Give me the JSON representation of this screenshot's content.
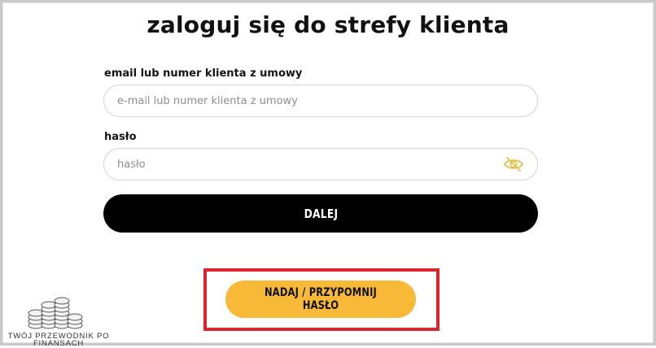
{
  "login": {
    "title": "zaloguj się do strefy klienta",
    "email_label": "email lub numer klienta z umowy",
    "email_placeholder": "e-mail lub numer klienta z umowy",
    "email_value": "",
    "password_label": "hasło",
    "password_placeholder": "hasło",
    "password_value": "",
    "password_toggle_icon": "eye-slash-icon",
    "next_button": "DALEJ",
    "forgot_button": "NADAJ / PRZYPOMNIJ HASŁO"
  },
  "colors": {
    "primary_button": "#000000",
    "secondary_button": "#f9b938",
    "highlight_border": "#d9252b",
    "eye_icon": "#e3c24a"
  },
  "watermark": {
    "line1": "TWÓJ PRZEWODNIK PO",
    "line2": "FINANSACH"
  }
}
